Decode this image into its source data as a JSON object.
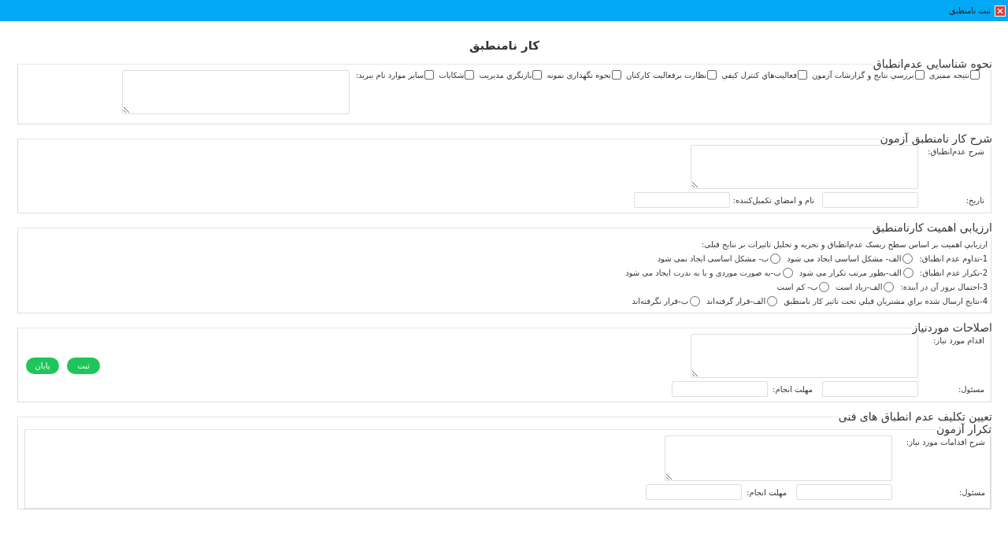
{
  "window": {
    "title": "ثبت نامنطبق"
  },
  "heading": "کار نامنطبق",
  "detection": {
    "legend": "نحوه شناسایی عدم‌انطباق",
    "options": [
      {
        "label": "نتیجه ممیزی",
        "checked": false
      },
      {
        "label": "بررسي نتايج و گزارشات آزمون",
        "checked": false
      },
      {
        "label": "فعالیت‌هاي کنترل کيفي",
        "checked": false
      },
      {
        "label": "نظارت برفعاليت کارکنان",
        "checked": false
      },
      {
        "label": "نحوه نگهداری نمونه",
        "checked": false
      },
      {
        "label": "بازنگري مديريت",
        "checked": false
      },
      {
        "label": "شکایات",
        "checked": false
      },
      {
        "label": "سایر موارد نام ببرید:",
        "checked": false
      }
    ]
  },
  "description": {
    "legend": "شرح کار نامنطبق آزمون",
    "desc_label": "شرح عدم‌انطباق:",
    "date_label": "تاریخ:",
    "signer_label": "نام و امضاي تکمیل‌کننده:"
  },
  "assessment": {
    "legend": "ارزیابی اهمیت کارنامنطبق",
    "intro": "ارزیابي اهمیت بر اساس سطح ریسک عدم‌انطباق و تجزیه و تحلیل تاثیرات بر نتایج قبلی:",
    "questions": [
      {
        "label": "1-تداوم عدم انطباق:",
        "options": [
          {
            "label": "الف- مشکل اساسی ایجاد می شود",
            "selected": false
          },
          {
            "label": "ب- مشکل اساسی ایجاد نمی شود",
            "selected": false
          }
        ]
      },
      {
        "label": "2-تکرار عدم انطباق:",
        "options": [
          {
            "label": "الف-بطور مرتب تکرار می شود",
            "selected": false
          },
          {
            "label": "ب-به صورت موردی و یا به ندرت ایجاد می شود",
            "selected": false
          }
        ]
      },
      {
        "label": "3-احتمال بروز آن در آینده:",
        "options": [
          {
            "label": "الف-زیاد است",
            "selected": false
          },
          {
            "label": "ب- کم است",
            "selected": false
          }
        ]
      },
      {
        "label": "4-نتايج ارسال شده براي مشتريان قبلي تحت تاثير کار نامنطبق",
        "options": [
          {
            "label": "الف-قرار گرفته‌اند",
            "selected": false
          },
          {
            "label": "ب-قرار نگرفته‌اند",
            "selected": false
          }
        ]
      }
    ]
  },
  "corrections": {
    "legend": "اصلاحات موردنیاز",
    "action_label": "اقدام مورد نیاز:",
    "responsible_label": "مسئول:",
    "deadline_label": "مهلت انجام:",
    "buttons": [
      "ثبت",
      "پایان"
    ]
  },
  "assignment": {
    "legend": "تعیین تکلیف عدم انطباق های فنی",
    "retest": {
      "legend": "تکرار آزمون",
      "desc_label": "شرح اقدامات مورد نیاز:",
      "responsible_label": "مسئول:",
      "deadline_label": "مهلت انجام:"
    }
  }
}
